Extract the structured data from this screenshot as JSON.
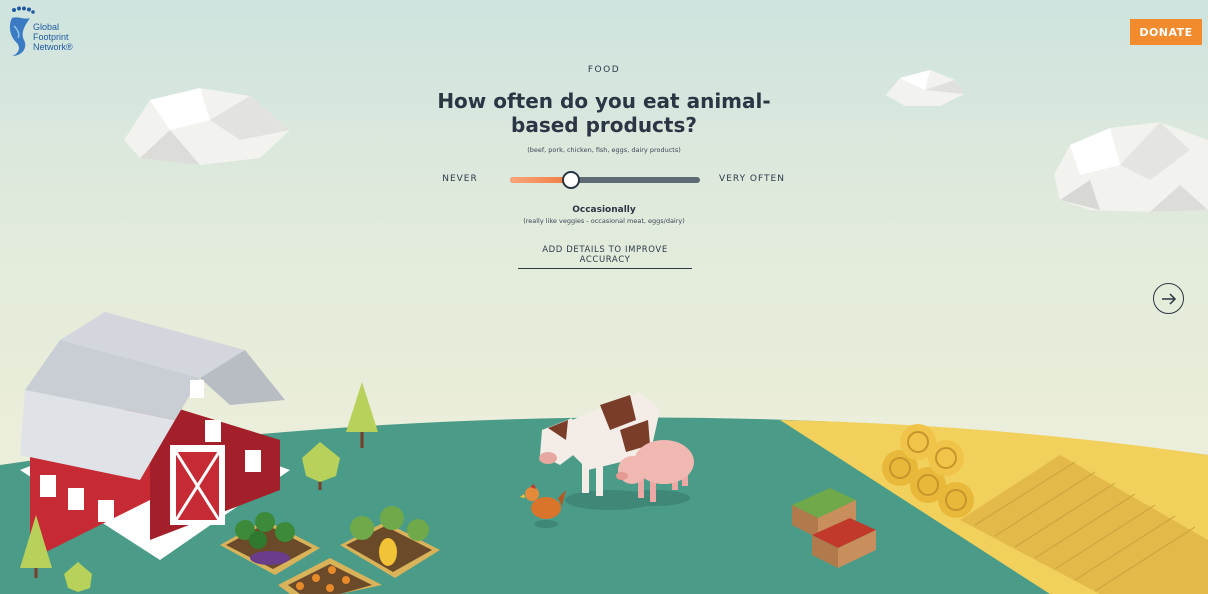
{
  "logo": {
    "lines": [
      "Global",
      "Footprint",
      "Network®"
    ],
    "icon": "footprint-logo-icon",
    "color": "#1f5aa0"
  },
  "header": {
    "donate_label": "DONATE",
    "donate_color": "#f28a2e"
  },
  "question": {
    "category": "FOOD",
    "title": "How often do you eat animal-based products?",
    "subtitle": "(beef, pork, chicken, fish, eggs, dairy products)"
  },
  "slider": {
    "min_label": "NEVER",
    "max_label": "VERY OFTEN",
    "value_fraction": 0.32,
    "current_label": "Occasionally",
    "current_description": "(really like veggies - occasional meat, eggs/dairy)"
  },
  "links": {
    "details": "ADD DETAILS TO IMPROVE ACCURACY"
  },
  "navigation": {
    "next_icon": "arrow-right-icon"
  },
  "scene": {
    "description_icons": [
      "cloud-icon",
      "barn-icon",
      "tree-icon",
      "cow-icon",
      "pig-icon",
      "chicken-icon",
      "hay-bale-icon",
      "crate-icon",
      "garden-icon",
      "field-icon"
    ],
    "colors": {
      "ground": "#4a9b88",
      "field": "#f2d05c",
      "barn": "#c62a34",
      "roof": "#c9cdd4"
    }
  }
}
